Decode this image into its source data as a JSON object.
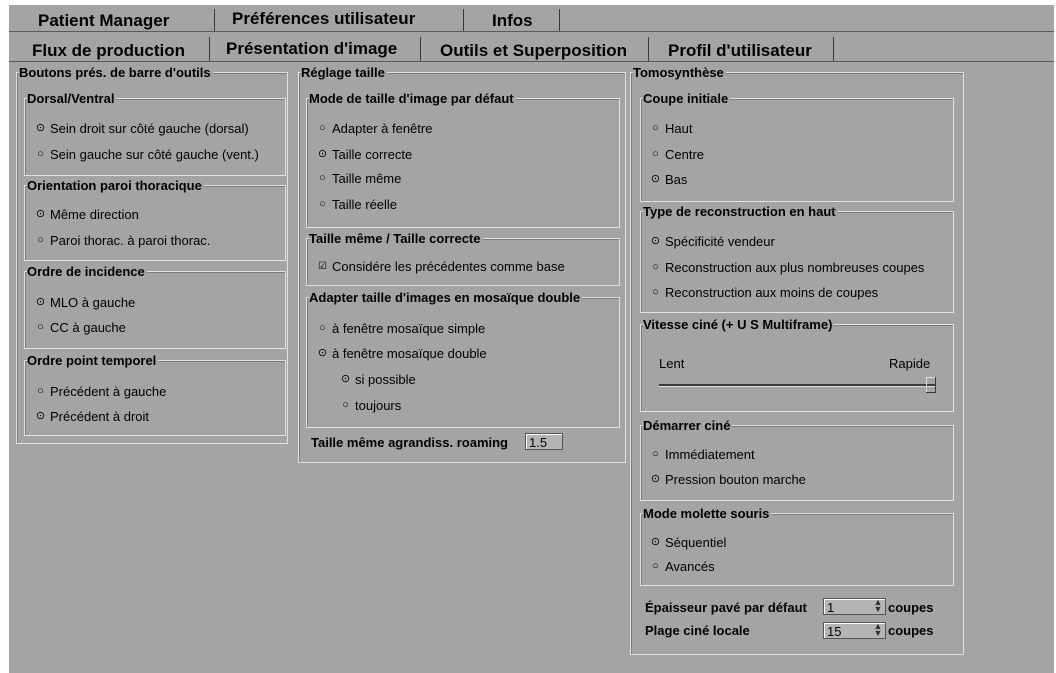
{
  "top_tabs": [
    "Patient Manager",
    "Préférences utilisateur",
    "Infos"
  ],
  "sub_tabs": [
    "Flux de production",
    "Présentation d'image",
    "Outils et Superposition",
    "Profil d'utilisateur"
  ],
  "toolbar_group": {
    "title": "Boutons prés. de barre d'outils",
    "dorsal": {
      "title": "Dorsal/Ventral",
      "options": [
        "Sein droit sur côté gauche (dorsal)",
        "Sein gauche sur côté gauche (vent.)"
      ],
      "selected": 0
    },
    "orientation": {
      "title": "Orientation paroi thoracique",
      "options": [
        "Même direction",
        "Paroi thorac. à paroi thorac."
      ],
      "selected": 0
    },
    "incidence": {
      "title": "Ordre de incidence",
      "options": [
        "MLO à gauche",
        "CC à gauche"
      ],
      "selected": 0
    },
    "temporal": {
      "title": "Ordre point temporel",
      "options": [
        "Précédent à gauche",
        "Précédent à droit"
      ],
      "selected": 1
    }
  },
  "size_group": {
    "title": "Réglage taille",
    "default_mode": {
      "title": "Mode de taille d'image par défaut",
      "options": [
        "Adapter à fenêtre",
        "Taille correcte",
        "Taille même",
        "Taille réelle"
      ],
      "selected": 1
    },
    "same_size": {
      "title": "Taille même / Taille correcte",
      "checkbox": "Considére les précédentes comme base",
      "checked": true
    },
    "mosaic": {
      "title": "Adapter taille d'images en mosaïque double",
      "options": [
        "à fenêtre mosaïque simple",
        "à fenêtre mosaïque double"
      ],
      "selected": 1,
      "sub_options": [
        "si possible",
        "toujours"
      ],
      "sub_selected": 0
    },
    "roaming_label": "Taille même agrandiss. roaming",
    "roaming_value": "1.5"
  },
  "tomo_group": {
    "title": "Tomosynthèse",
    "initial_slice": {
      "title": "Coupe initiale",
      "options": [
        "Haut",
        "Centre",
        "Bas"
      ],
      "selected": 2
    },
    "recon_type": {
      "title": "Type de reconstruction en haut",
      "options": [
        "Spécificité vendeur",
        "Reconstruction aux plus nombreuses coupes",
        "Reconstruction aux moins de coupes"
      ],
      "selected": 0
    },
    "cine_speed": {
      "title": "Vitesse ciné (+ U S Multiframe)",
      "slow": "Lent",
      "fast": "Rapide",
      "value": 1.0
    },
    "cine_start": {
      "title": "Démarrer ciné",
      "options": [
        "Immédiatement",
        "Pression bouton marche"
      ],
      "selected": 1
    },
    "wheel_mode": {
      "title": "Mode molette souris",
      "options": [
        "Séquentiel",
        "Avancés"
      ],
      "selected": 0
    },
    "slab_label": "Épaisseur pavé par défaut",
    "slab_value": "1",
    "slab_unit": "coupes",
    "cine_range_label": "Plage ciné locale",
    "cine_range_value": "15",
    "cine_range_unit": "coupes"
  }
}
